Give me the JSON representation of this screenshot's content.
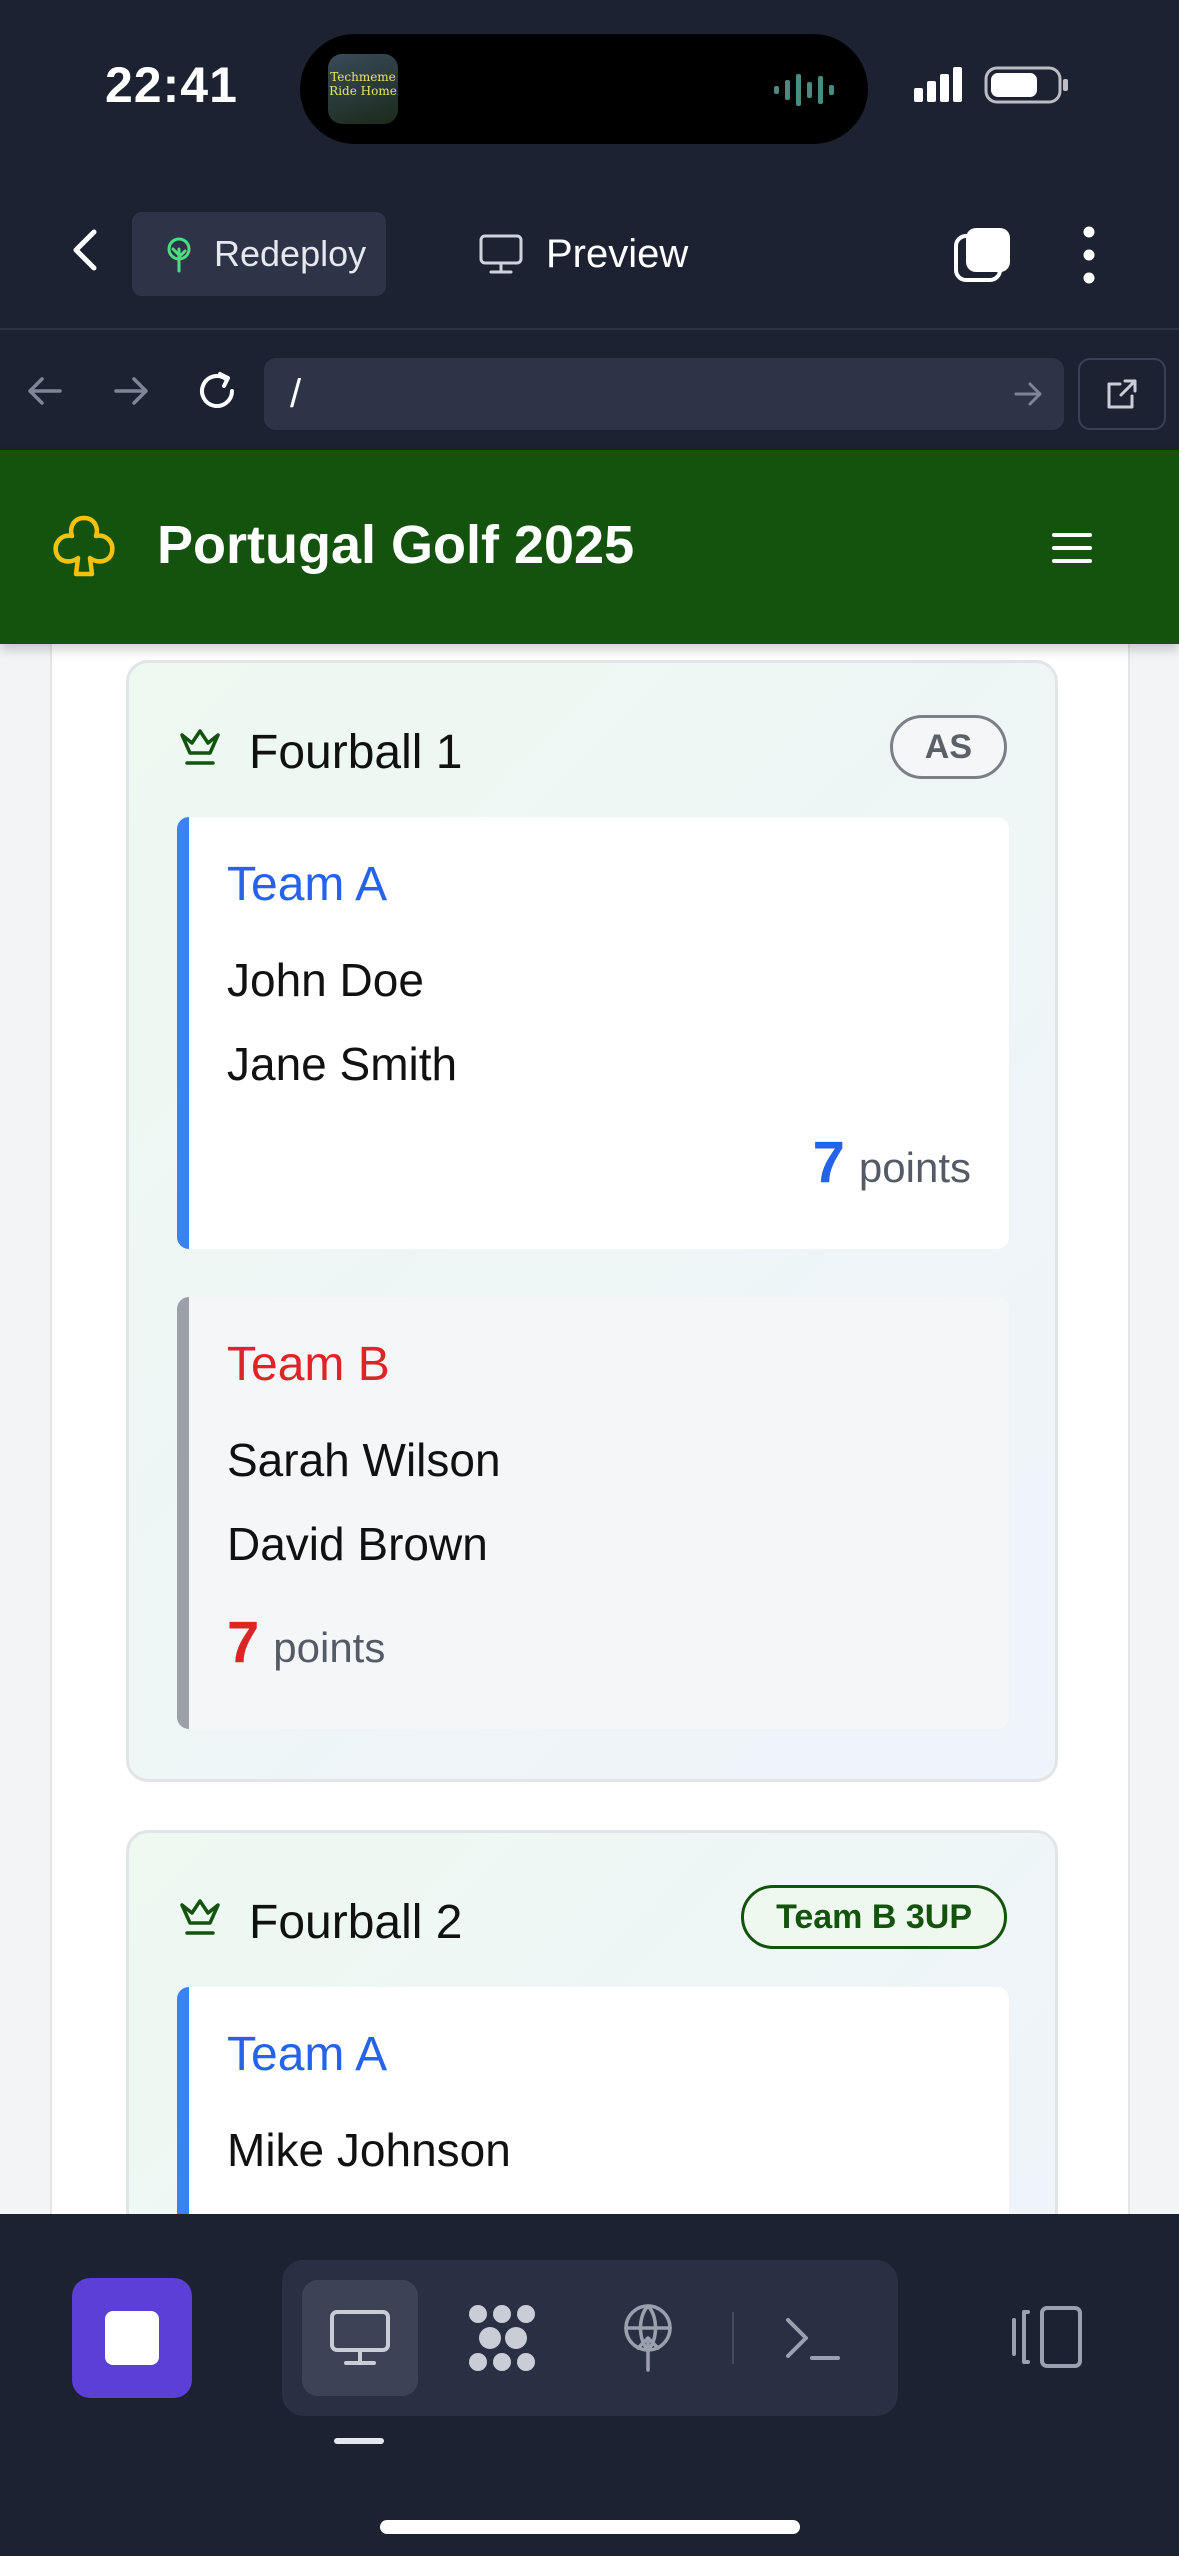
{
  "status_bar": {
    "time": "22:41",
    "island_art_text": "Techmeme Ride Home"
  },
  "app_bar": {
    "redeploy_label": "Redeploy",
    "preview_label": "Preview"
  },
  "browser": {
    "url": "/"
  },
  "site": {
    "title": "Portugal Golf 2025",
    "header_color": "#14530e",
    "club_icon_color": "#f4c20d"
  },
  "matches": [
    {
      "title": "Fourball 1",
      "status": "AS",
      "team_a": {
        "name": "Team A",
        "players": [
          "John Doe",
          "Jane Smith"
        ],
        "points": "7",
        "points_label": "points"
      },
      "team_b": {
        "name": "Team B",
        "players": [
          "Sarah Wilson",
          "David Brown"
        ],
        "points": "7",
        "points_label": "points"
      }
    },
    {
      "title": "Fourball 2",
      "status": "Team B 3UP",
      "team_a": {
        "name": "Team A",
        "players": [
          "Mike Johnson"
        ]
      }
    }
  ],
  "colors": {
    "team_a": "#2563eb",
    "team_b": "#dc2626",
    "stop_button": "#5b3fd6"
  },
  "toolbar": {
    "icons": [
      "stop-icon",
      "desktop-icon",
      "nodes-icon",
      "deploy-icon",
      "terminal-icon",
      "panel-icon"
    ]
  }
}
